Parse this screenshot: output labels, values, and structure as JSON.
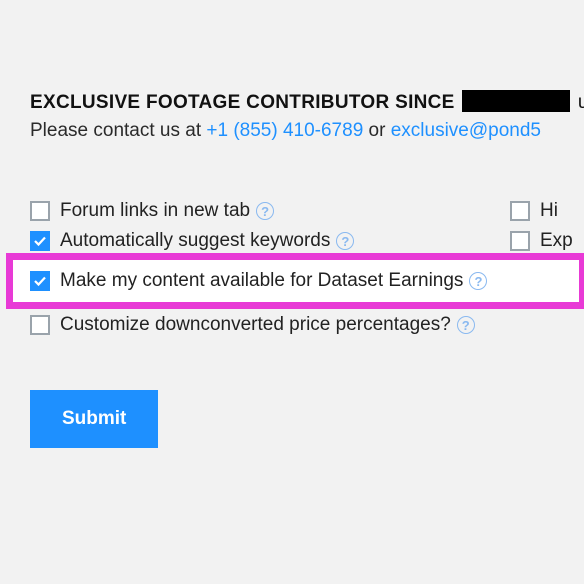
{
  "header": {
    "title_prefix": "EXCLUSIVE FOOTAGE CONTRIBUTOR SINCE",
    "title_suffix": "under",
    "contact_prefix": "Please contact us at ",
    "phone": "+1 (855) 410-6789",
    "contact_or": " or ",
    "email": "exclusive@pond5"
  },
  "options": {
    "forum_links": "Forum links in new tab",
    "auto_keywords": "Automatically suggest keywords",
    "dataset_earnings": "Make my content available for Dataset Earnings",
    "customize_price": "Customize downconverted price percentages?",
    "right_hi": "Hi",
    "right_exp": "Exp"
  },
  "buttons": {
    "submit": "Submit"
  },
  "help_glyph": "?"
}
